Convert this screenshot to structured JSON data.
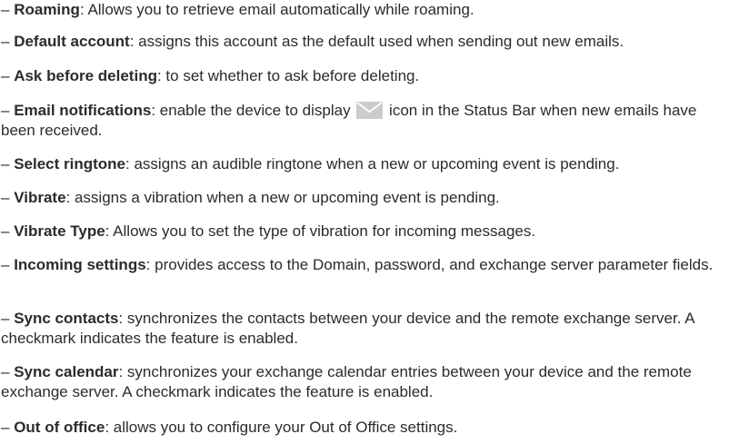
{
  "dash": "–",
  "items": [
    {
      "term": "Roaming",
      "desc": ": Allows you to retrieve email automatically while roaming."
    },
    {
      "term": "Default account",
      "desc": ": assigns this account as the default used when sending out new emails."
    },
    {
      "term": "Ask before deleting",
      "desc": ": to set whether to ask before deleting."
    },
    {
      "term": "Email notifications",
      "desc_before": ": enable the device to display ",
      "icon": "envelope-icon",
      "desc_after": " icon in the Status Bar when new emails have been received."
    },
    {
      "term": "Select ringtone",
      "desc": ": assigns an audible ringtone when a new or upcoming event is pending."
    },
    {
      "term": "Vibrate",
      "desc": ": assigns a vibration when a new or upcoming event is pending."
    },
    {
      "term": "Vibrate Type",
      "desc": ": Allows you to set the type of vibration for incoming messages."
    },
    {
      "term": "Incoming settings",
      "desc": ": provides access to the Domain, password, and exchange server parameter fields."
    },
    {
      "term": "Sync contacts",
      "desc": ": synchronizes the contacts between your device and the remote exchange server. A checkmark indicates the feature is enabled."
    },
    {
      "term": "Sync calendar",
      "desc": ": synchronizes your exchange calendar entries between your device and the remote exchange server. A checkmark indicates the feature is enabled."
    },
    {
      "term": "Out of office",
      "desc": ": allows you to configure your Out of Office settings."
    }
  ],
  "colors": {
    "text": "#2b2b2b",
    "icon_fill": "#c9cbcd",
    "icon_stroke": "#ffffff"
  }
}
